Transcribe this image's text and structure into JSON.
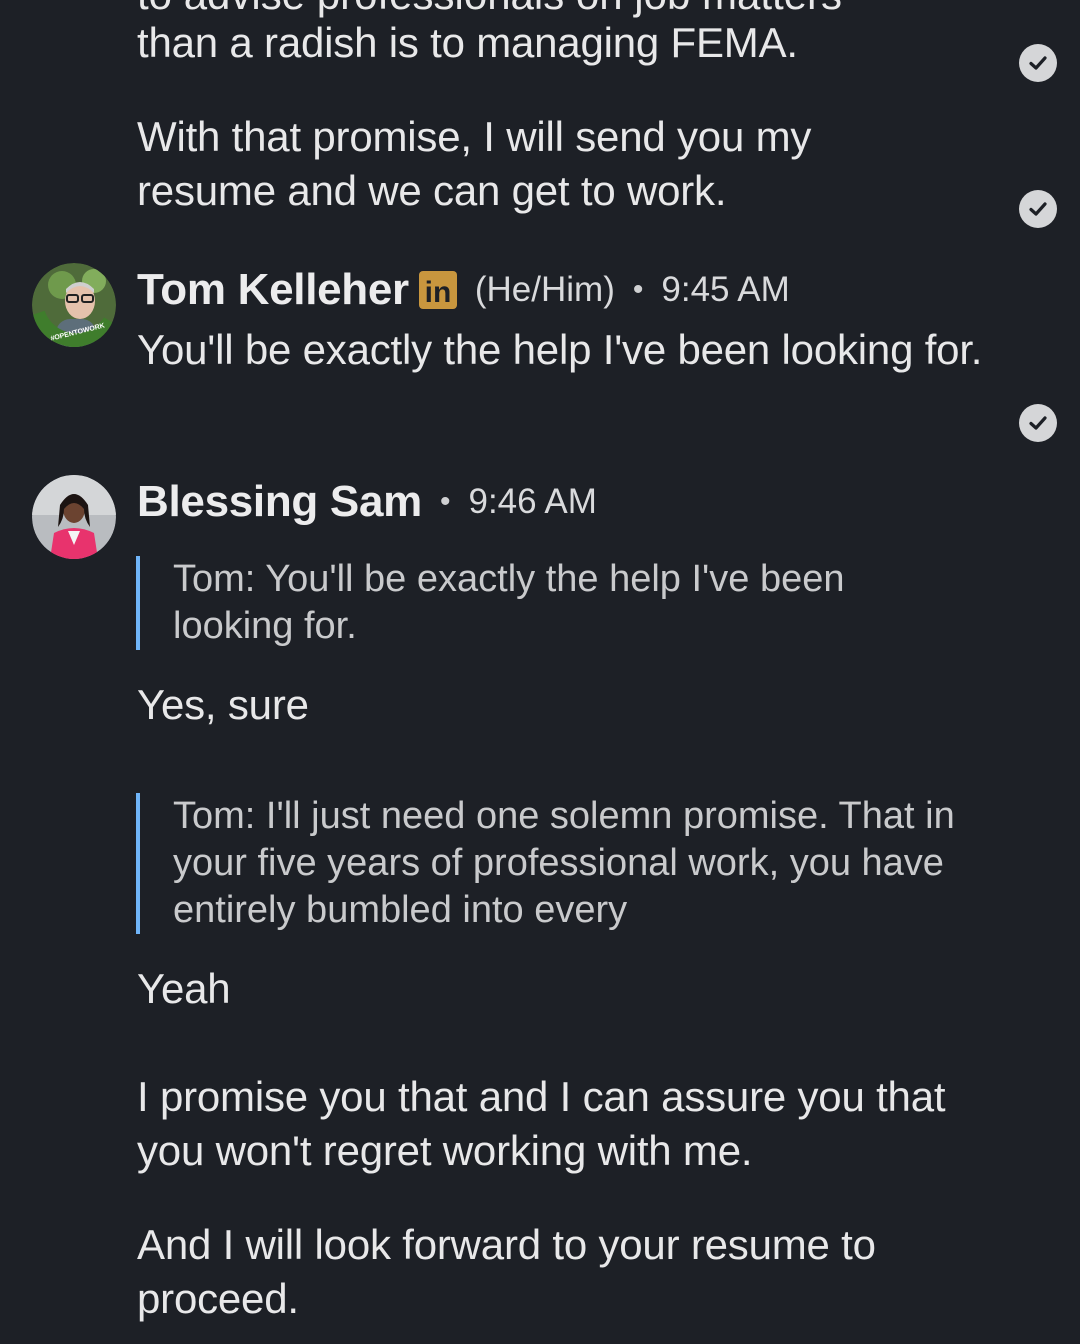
{
  "messages_top": {
    "cut_line": "to advise professionals on job matters",
    "msg1": "than a radish is to managing FEMA.",
    "msg2": "With that promise, I will send you my resume and we can get to work."
  },
  "tom": {
    "name": "Tom Kelleher",
    "badge": "in",
    "pronouns": "(He/Him)",
    "separator": "•",
    "time": "9:45 AM",
    "avatar_frame_text": "#OPENTOWORK",
    "message": "You'll be exactly the help I've been looking for."
  },
  "blessing": {
    "name": "Blessing Sam",
    "separator": "•",
    "time": "9:46 AM",
    "quote1": "Tom: You'll be exactly the help I've been looking for.",
    "reply1": "Yes, sure",
    "quote2": "Tom: I'll just need one solemn promise. That in your five years of professional work, you have entirely bumbled into every",
    "reply2": "Yeah",
    "msg3": "I promise you that and I can assure you that you won't regret working with me.",
    "msg4": "And I will look forward to your resume to proceed."
  },
  "icons": {
    "read_receipt": "check-circle-icon",
    "linkedin_badge": "linkedin-icon"
  },
  "colors": {
    "background": "#1d2026",
    "quote_bar": "#70b5f9",
    "linkedin_badge": "#c8963e",
    "open_to_work": "#3f7d2c"
  }
}
